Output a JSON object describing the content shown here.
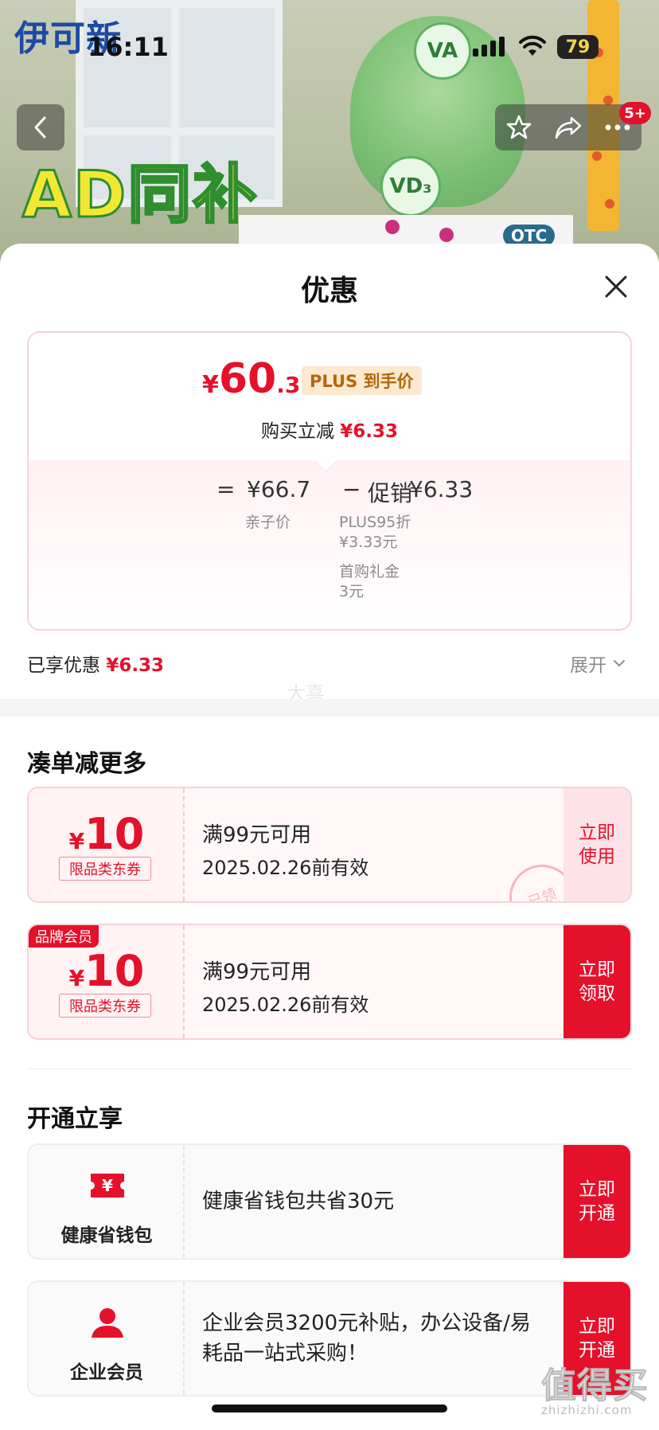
{
  "colors": {
    "accent": "#e5102a",
    "brand_blue": "#1c4aa5"
  },
  "hero": {
    "brand": "伊可新",
    "headline": "AD同补",
    "ball_labels": [
      "VA",
      "VD₃"
    ],
    "otc_label": "OTC"
  },
  "status_bar": {
    "time": "16:11",
    "battery": "79"
  },
  "nav": {
    "badge": "5+"
  },
  "sheet": {
    "title": "优惠",
    "price": {
      "currency": "¥",
      "integer": "60",
      "decimal": ".37",
      "tag": "PLUS 到手价",
      "buy_label": "购买立减",
      "buy_amount": "¥6.33"
    },
    "calc": {
      "equals": "=",
      "base_value": "¥66.7",
      "base_label": "亲子价",
      "minus": "−",
      "promo_label": "促销",
      "promo_value": "¥6.33",
      "promo_detail_1_name": "PLUS95折",
      "promo_detail_1_value": "¥3.33元",
      "promo_detail_2_name": "首购礼金",
      "promo_detail_2_value": "3元"
    },
    "enjoyed_label": "已享优惠",
    "enjoyed_value": "¥6.33",
    "expand_label": "展开",
    "watermark": "大喜_"
  },
  "more_section": {
    "title": "凑单减更多",
    "coupons": [
      {
        "currency": "¥",
        "amount": "10",
        "kind": "限品类东券",
        "condition": "满99元可用",
        "valid": "2025.02.26前有效",
        "action": "立即使用",
        "stamp": "已领"
      },
      {
        "tag": "品牌会员",
        "currency": "¥",
        "amount": "10",
        "kind": "限品类东券",
        "condition": "满99元可用",
        "valid": "2025.02.26前有效",
        "action": "立即领取"
      }
    ]
  },
  "open_section": {
    "title": "开通立享",
    "items": [
      {
        "icon": "wallet-yen-icon",
        "name": "健康省钱包",
        "desc": "健康省钱包共省30元",
        "action": "立即开通"
      },
      {
        "icon": "person-icon",
        "name": "企业会员",
        "desc": "企业会员3200元补贴，办公设备/易耗品一站式采购！",
        "action": "立即开通"
      }
    ]
  },
  "corner_watermark": {
    "main": "值得买",
    "sub": "zhizhizhi.com"
  }
}
